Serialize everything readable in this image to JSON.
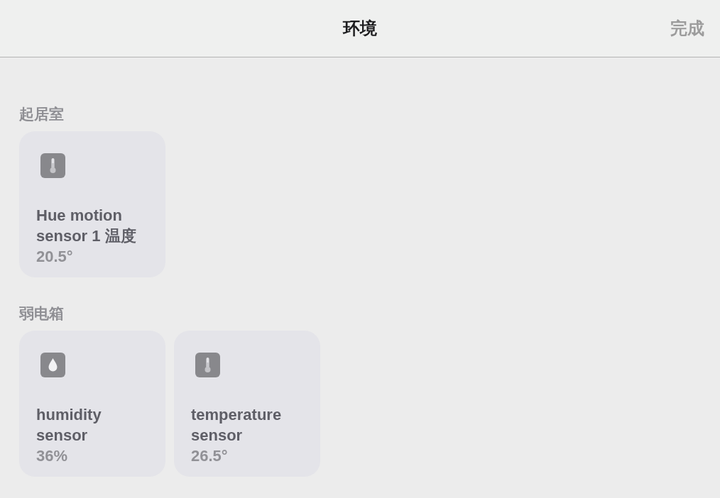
{
  "nav": {
    "title": "环境",
    "done": "完成"
  },
  "rooms": [
    {
      "name": "起居室",
      "sensors": [
        {
          "kind": "temperature",
          "name": "Hue motion sensor 1 温度",
          "reading": "20.5°"
        }
      ]
    },
    {
      "name": "弱电箱",
      "sensors": [
        {
          "kind": "humidity",
          "name": "humidity sensor",
          "reading": "36%"
        },
        {
          "kind": "temperature",
          "name": "temperature sensor",
          "reading": "26.5°"
        }
      ]
    }
  ]
}
